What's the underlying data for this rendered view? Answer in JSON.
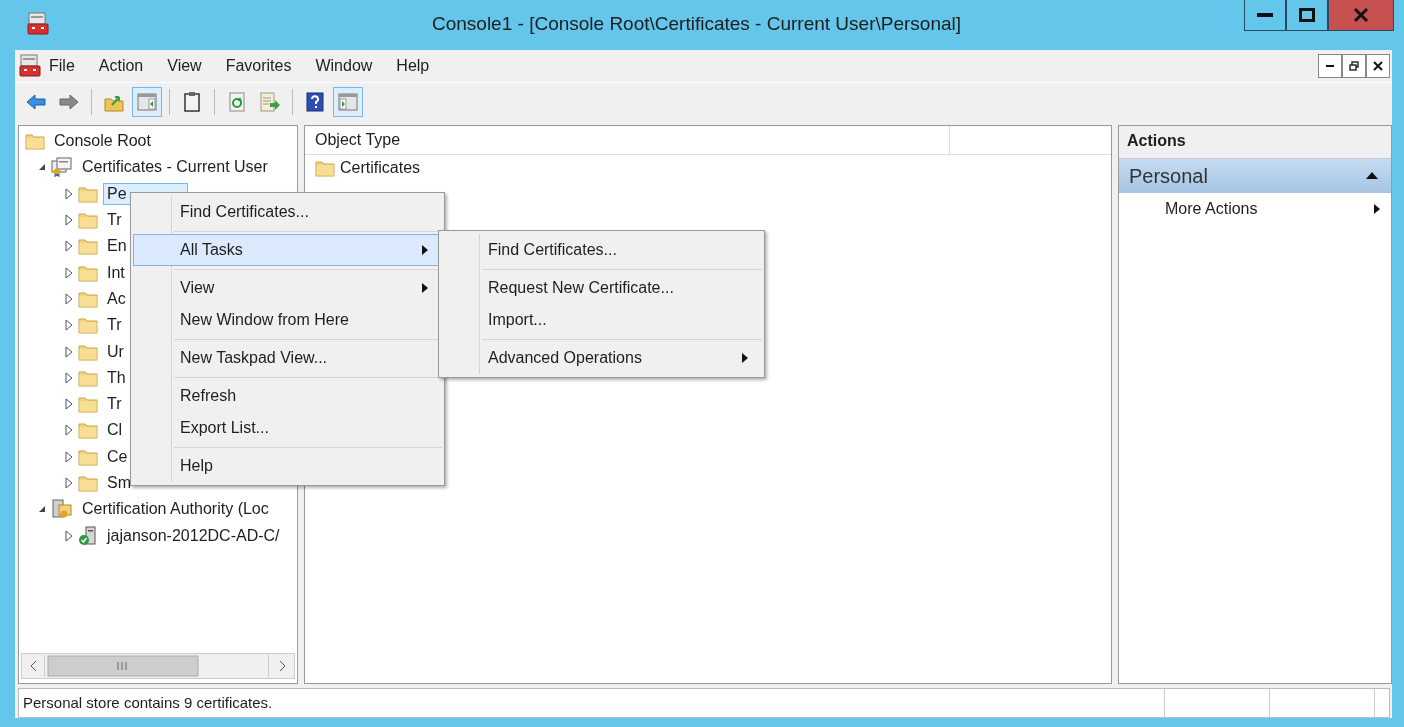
{
  "window": {
    "title": "Console1 - [Console Root\\Certificates - Current User\\Personal]"
  },
  "menu_bar": [
    "File",
    "Action",
    "View",
    "Favorites",
    "Window",
    "Help"
  ],
  "toolbar": [
    {
      "kind": "back",
      "pressed": false
    },
    {
      "kind": "forward",
      "pressed": false
    },
    {
      "kind": "separator"
    },
    {
      "kind": "up",
      "pressed": false
    },
    {
      "kind": "tree-toggle",
      "pressed": true
    },
    {
      "kind": "separator"
    },
    {
      "kind": "clipboard",
      "pressed": false
    },
    {
      "kind": "separator"
    },
    {
      "kind": "refresh",
      "pressed": false
    },
    {
      "kind": "export",
      "pressed": false
    },
    {
      "kind": "separator"
    },
    {
      "kind": "help",
      "pressed": false
    },
    {
      "kind": "action-toggle",
      "pressed": true
    }
  ],
  "tree": [
    {
      "label": "Console Root",
      "kind": "folder",
      "selected": false,
      "children": [
        {
          "label": "Certificates - Current User",
          "kind": "cert-store",
          "expanded": true,
          "selected": false,
          "children": [
            {
              "label": "Pe",
              "kind": "folder",
              "expanded": false,
              "selected": true
            },
            {
              "label": "Tr",
              "kind": "folder",
              "expanded": false,
              "selected": false
            },
            {
              "label": "En",
              "kind": "folder",
              "expanded": false,
              "selected": false
            },
            {
              "label": "Int",
              "kind": "folder",
              "expanded": false,
              "selected": false
            },
            {
              "label": "Ac",
              "kind": "folder",
              "expanded": false,
              "selected": false
            },
            {
              "label": "Tr",
              "kind": "folder",
              "expanded": false,
              "selected": false
            },
            {
              "label": "Ur",
              "kind": "folder",
              "expanded": false,
              "selected": false
            },
            {
              "label": "Th",
              "kind": "folder",
              "expanded": false,
              "selected": false
            },
            {
              "label": "Tr",
              "kind": "folder",
              "expanded": false,
              "selected": false
            },
            {
              "label": "Cl",
              "kind": "folder",
              "expanded": false,
              "selected": false
            },
            {
              "label": "Ce",
              "kind": "folder",
              "expanded": false,
              "selected": false
            },
            {
              "label": "Sm",
              "kind": "folder",
              "expanded": false,
              "selected": false
            }
          ]
        },
        {
          "label": "Certification Authority (Loc",
          "kind": "ca",
          "expanded": true,
          "selected": false,
          "children": [
            {
              "label": "jajanson-2012DC-AD-C/",
              "kind": "server",
              "expanded": false,
              "selected": false
            }
          ]
        }
      ]
    }
  ],
  "content": {
    "columns": [
      "Object Type"
    ],
    "rows": [
      "Certificates"
    ]
  },
  "context_menu": [
    {
      "kind": "item",
      "label": "Find Certificates...",
      "submenu": false,
      "selected": false
    },
    {
      "kind": "separator"
    },
    {
      "kind": "item",
      "label": "All Tasks",
      "submenu": true,
      "selected": true
    },
    {
      "kind": "separator"
    },
    {
      "kind": "item",
      "label": "View",
      "submenu": true,
      "selected": false
    },
    {
      "kind": "item",
      "label": "New Window from Here",
      "submenu": false,
      "selected": false
    },
    {
      "kind": "separator"
    },
    {
      "kind": "item",
      "label": "New Taskpad View...",
      "submenu": false,
      "selected": false
    },
    {
      "kind": "separator"
    },
    {
      "kind": "item",
      "label": "Refresh",
      "submenu": false,
      "selected": false
    },
    {
      "kind": "item",
      "label": "Export List...",
      "submenu": false,
      "selected": false
    },
    {
      "kind": "separator"
    },
    {
      "kind": "item",
      "label": "Help",
      "submenu": false,
      "selected": false
    }
  ],
  "submenu": [
    {
      "kind": "item",
      "label": "Find Certificates...",
      "submenu": false,
      "selected": false
    },
    {
      "kind": "separator"
    },
    {
      "kind": "item",
      "label": "Request New Certificate...",
      "submenu": false,
      "selected": false
    },
    {
      "kind": "item",
      "label": "Import...",
      "submenu": false,
      "selected": false
    },
    {
      "kind": "separator"
    },
    {
      "kind": "item",
      "label": "Advanced Operations",
      "submenu": true,
      "selected": false
    }
  ],
  "actions": {
    "title": "Actions",
    "section": "Personal",
    "items": [
      {
        "label": "More Actions",
        "submenu": true
      }
    ]
  },
  "status_bar": "Personal store contains 9 certificates."
}
